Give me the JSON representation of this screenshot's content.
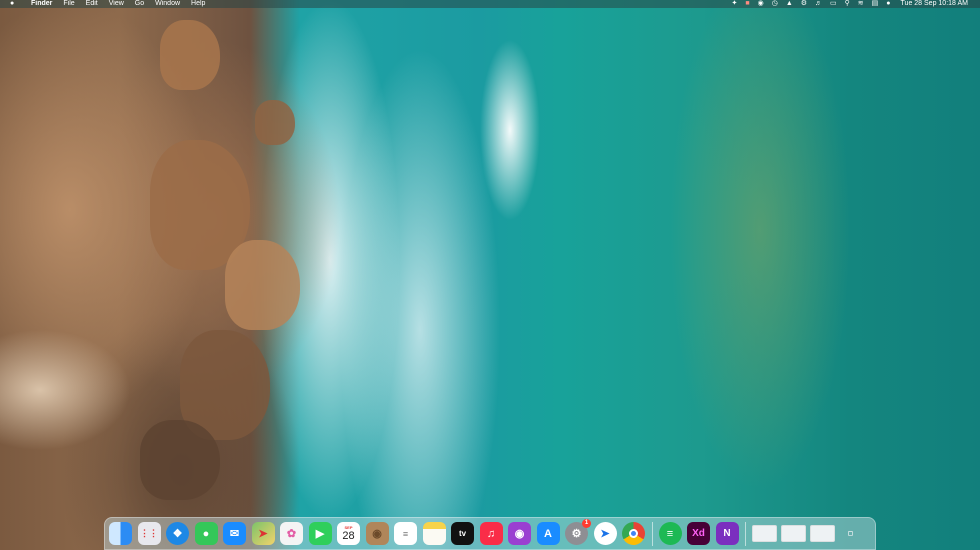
{
  "menubar": {
    "apple_icon": "",
    "app_name": "Finder",
    "menus": [
      "File",
      "Edit",
      "View",
      "Go",
      "Window",
      "Help"
    ],
    "status_icons": [
      "extension-icon",
      "notification-icon",
      "record-icon",
      "timer-icon",
      "adobe-icon",
      "gear-icon",
      "volume-icon",
      "battery-icon",
      "spotlight-icon",
      "wifi-icon",
      "control-center-icon",
      "siri-icon"
    ],
    "datetime": "Tue 28 Sep  10:18 AM"
  },
  "dock": {
    "apps": [
      {
        "name": "Finder",
        "icon": "finder-icon",
        "color": "#2c8cf4"
      },
      {
        "name": "Launchpad",
        "icon": "launchpad-icon",
        "color": "#e8e8ee"
      },
      {
        "name": "Safari",
        "icon": "safari-icon",
        "color": "#1e88e5"
      },
      {
        "name": "Messages",
        "icon": "messages-icon",
        "color": "#34c759"
      },
      {
        "name": "Mail",
        "icon": "mail-icon",
        "color": "#1a8cff"
      },
      {
        "name": "Maps",
        "icon": "maps-icon",
        "color": "#7cc36a"
      },
      {
        "name": "Photos",
        "icon": "photos-icon",
        "color": "#f4f4f4"
      },
      {
        "name": "FaceTime",
        "icon": "facetime-icon",
        "color": "#2fcf5b"
      },
      {
        "name": "Calendar",
        "icon": "calendar-icon",
        "color": "#ffffff",
        "month": "SEP",
        "day": "28"
      },
      {
        "name": "Contacts",
        "icon": "contacts-icon",
        "color": "#b0865a"
      },
      {
        "name": "Reminders",
        "icon": "reminders-icon",
        "color": "#ffffff"
      },
      {
        "name": "Notes",
        "icon": "notes-icon",
        "color": "#f7e27a"
      },
      {
        "name": "TV",
        "icon": "tv-icon",
        "color": "#111111",
        "label": "tv"
      },
      {
        "name": "Music",
        "icon": "music-icon",
        "color": "#fa2d48"
      },
      {
        "name": "Podcasts",
        "icon": "podcasts-icon",
        "color": "#9a3fd1"
      },
      {
        "name": "App Store",
        "icon": "app-store-icon",
        "color": "#1a8cff"
      },
      {
        "name": "System Preferences",
        "icon": "system-preferences-icon",
        "color": "#8e8e93",
        "badge": "1"
      },
      {
        "name": "Navigator",
        "icon": "navigator-icon",
        "color": "#ffffff"
      },
      {
        "name": "Chrome",
        "icon": "chrome-icon",
        "color": "#ffffff"
      }
    ],
    "apps2": [
      {
        "name": "Spotify",
        "icon": "spotify-icon",
        "color": "#1db954"
      },
      {
        "name": "Adobe XD",
        "icon": "adobe-xd-icon",
        "color": "#470137",
        "label": "Xd"
      },
      {
        "name": "OneNote",
        "icon": "onenote-icon",
        "color": "#7b2fbf",
        "label": "N"
      }
    ],
    "trash_icon": "trash-icon"
  }
}
